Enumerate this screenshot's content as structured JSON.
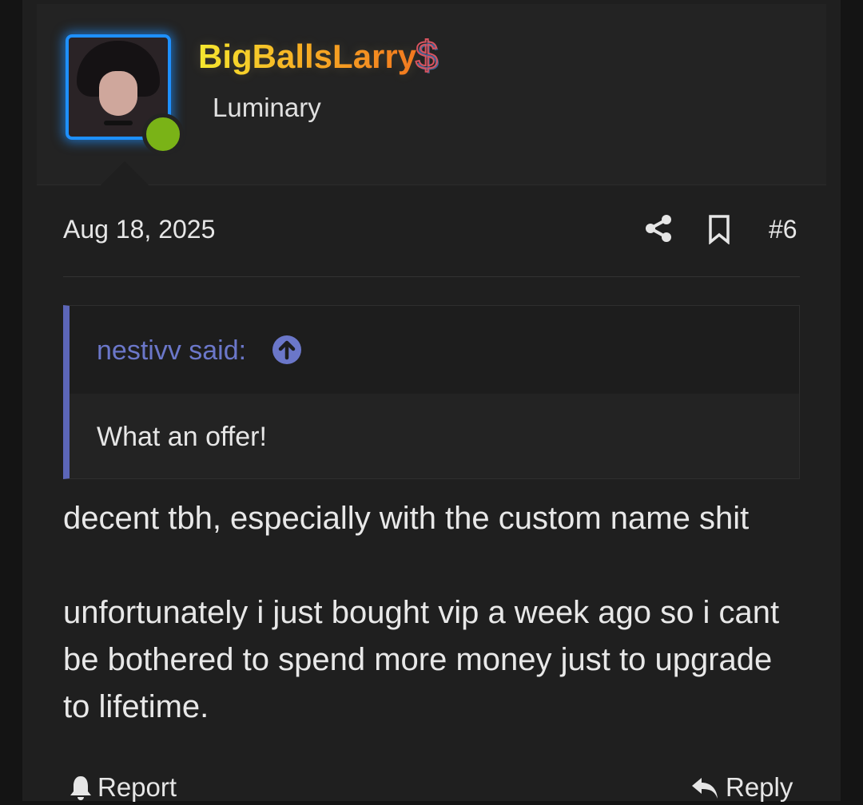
{
  "user": {
    "name": "BigBallsLarry",
    "title": "Luminary",
    "badge_icon": "dollar-sign-icon",
    "badge_glyph": "$",
    "online": true,
    "online_color": "#7ab317",
    "avatar_border_color": "#1e90ff"
  },
  "post": {
    "date": "Aug 18, 2025",
    "number": "#6",
    "actions": {
      "share_icon": "share-icon",
      "bookmark_icon": "bookmark-icon"
    },
    "quote": {
      "author": "nestivv said:",
      "text": "What an offer!",
      "accent_color": "#5c66b8",
      "jump_icon": "arrow-up-circle-icon"
    },
    "body": {
      "paragraph1": "decent tbh, especially with the custom name shit",
      "paragraph2": "unfortunately i just bought vip a week ago so i cant be bothered to spend more money just to upgrade to lifetime."
    },
    "footer": {
      "report_label": "Report",
      "reply_label": "Reply"
    }
  }
}
